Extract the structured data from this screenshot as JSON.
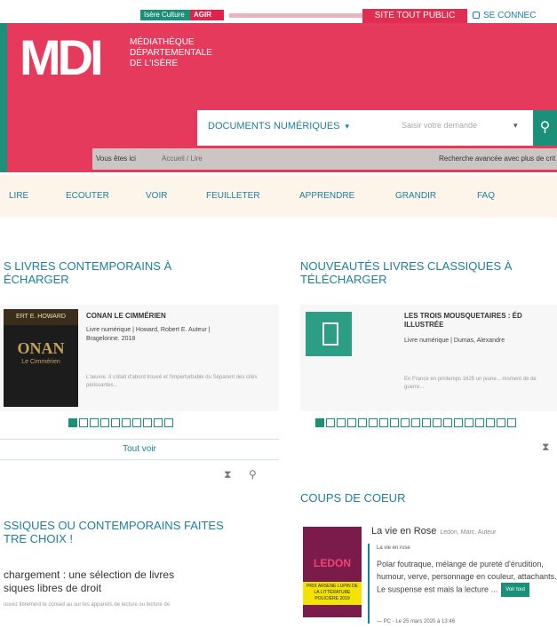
{
  "topbar": {
    "pill_left": "Isère Culture",
    "pill_right": "AGIR",
    "public_link": "SITE TOUT PUBLIC",
    "connect_link": "SE CONNEC"
  },
  "header": {
    "logo": "MDI",
    "subtitle_1": "MÉDIATHÈQUE",
    "subtitle_2": "DÉPARTEMENTALE",
    "subtitle_3": "DE L'ISÈRE"
  },
  "search": {
    "scope_label": "DOCUMENTS NUMÉRIQUES",
    "placeholder": "Saisir votre demande"
  },
  "breadcrumb": {
    "label": "Vous êtes ici",
    "path": "Accueil / Lire",
    "advanced": "Recherche avancée avec plus de crit"
  },
  "nav": {
    "items": [
      "LIRE",
      "ECOUTER",
      "VOIR",
      "FEUILLETER",
      "APPRENDRE",
      "GRANDIR",
      "FAQ"
    ]
  },
  "left": {
    "heading_1": "S LIVRES CONTEMPORAINS À",
    "heading_2": "ÉCHARGER",
    "book_title": "CONAN LE CIMMÉRIEN",
    "book_meta_1": "Livre numérique | Howard, Robert E. Auteur |",
    "book_meta_2": "Bragelonne. 2018",
    "book_desc": "L'œuvre. Il s'était d'abord trouvé et l'imperturbable du Séparent des cités périssantes...",
    "cover_top": "ERT E. HOWARD",
    "cover_title": "ONAN",
    "cover_sub": "Le Cimmérien",
    "see_all": "Tout voir"
  },
  "right": {
    "heading_1": "NOUVEAUTÉS LIVRES CLASSIQUES À",
    "heading_2": "TÉLÉCHARGER",
    "book_title_1": "LES TROIS MOUSQUETAIRES : ÉD",
    "book_title_2": "ILLUSTRÉE",
    "book_meta": "Livre numérique | Dumas, Alexandre",
    "book_desc": "En France en printemps 1625 un jeune... moment de de guerre..."
  },
  "bottom_left": {
    "heading_1": "SSIQUES OU CONTEMPORAINS FAITES",
    "heading_2": "TRE CHOIX !",
    "lead_1": "chargement : une sélection de livres",
    "lead_2": "siques libres de droit",
    "lead_desc": "ouvez librement le conseil au sur les appareils de lecture ou lecture de"
  },
  "coup_de_coeur": {
    "heading": "COUPS DE COEUR",
    "title": "La vie en Rose",
    "author": "Ledon, Marc. Auteur",
    "date": "La vie en rose",
    "text": "Polar foutraque, mélange de pureté d'érudition, humour, verve, personnage en couleur, attachants. Le suspense est mais la lecture ...",
    "more": "Voir tout",
    "footer": "— PC - Le 25 mars 2020 à 13:46",
    "cover_big": "LEDON",
    "cover_band": "PRIX ARSENE LUPIN DE LA LITTÉRATURE POLICIÈRE 2019"
  }
}
